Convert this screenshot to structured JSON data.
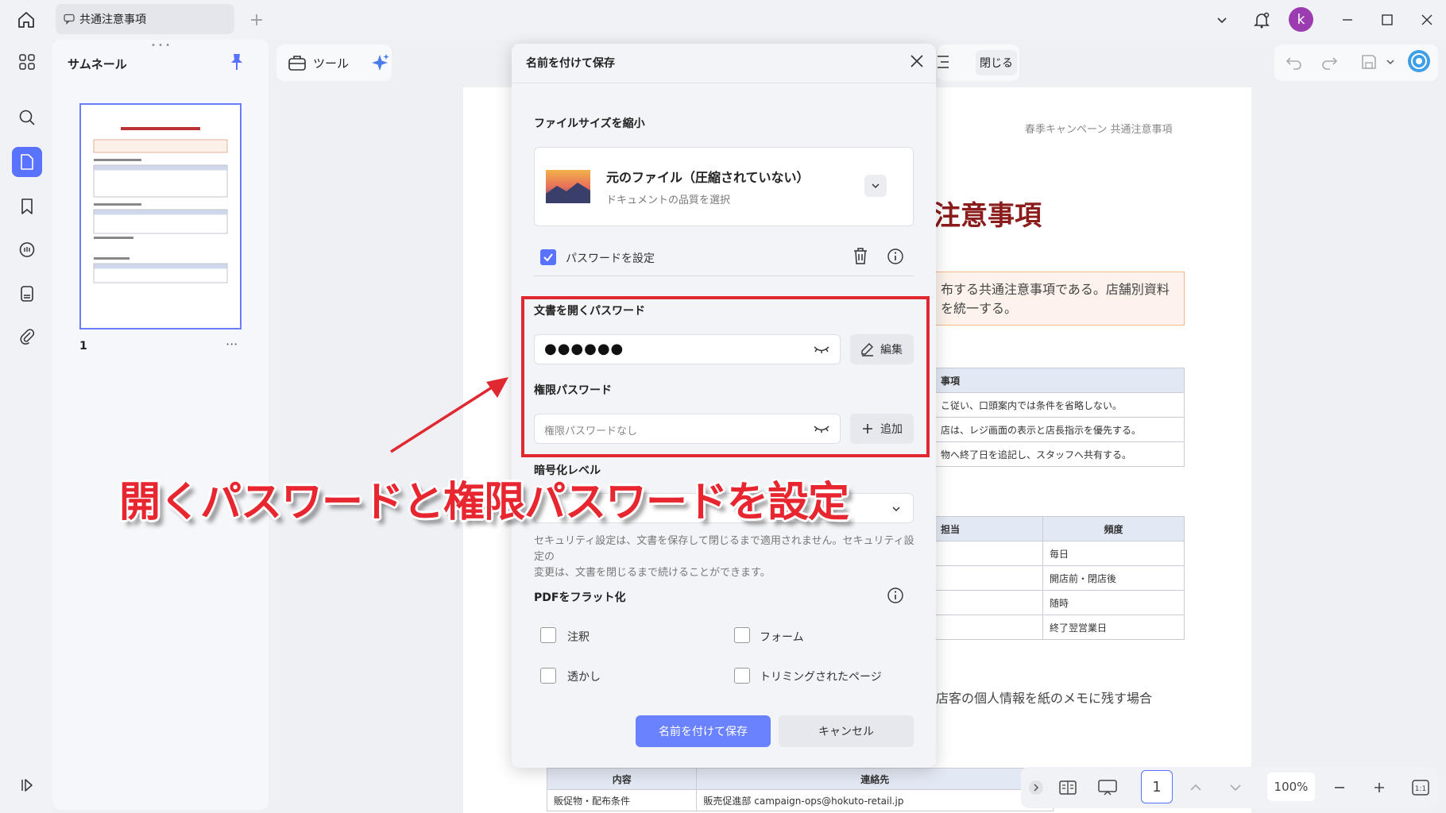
{
  "titlebar": {
    "tab_label": "共通注意事項",
    "new_tab": "+",
    "avatar_initial": "k"
  },
  "thumbnails": {
    "title": "サムネール",
    "page_number": "1",
    "more": "···"
  },
  "toolbar": {
    "tools_label": "ツール",
    "close_label": "閉じる"
  },
  "document": {
    "header": "春季キャンペーン 共通注意事項",
    "title": "注意事項",
    "notice": [
      "布する共通注意事項である。店舗別資料",
      "を統一する。"
    ],
    "table1": {
      "header": "事項",
      "rows": [
        "こ従い、口頭案内では条件を省略しない。",
        "店は、レジ画面の表示と店長指示を優先する。",
        "物へ終了日を追記し、スタッフへ共有する。"
      ]
    },
    "table2": {
      "headers": [
        "担当",
        "頻度"
      ],
      "rows": [
        [
          "",
          "毎日"
        ],
        [
          "",
          "開店前・閉店後"
        ],
        [
          "",
          "随時"
        ],
        [
          "",
          "終了翌営業日"
        ]
      ]
    },
    "line": "店客の個人情報を紙のメモに残す場合",
    "table3": {
      "headers": [
        "内容",
        "連絡先"
      ],
      "rows": [
        [
          "販促物・配布条件",
          "販売促進部 campaign-ops@hokuto-retail.jp"
        ]
      ]
    }
  },
  "dialog": {
    "title": "名前を付けて保存",
    "compress_label": "ファイルサイズを縮小",
    "compress_option_title": "元のファイル（圧縮されていない）",
    "compress_option_sub": "ドキュメントの品質を選択",
    "set_password_label": "パスワードを設定",
    "open_password_label": "文書を開くパスワード",
    "open_password_value": "●●●●●●",
    "edit_label": "編集",
    "permission_password_label": "権限パスワード",
    "permission_password_placeholder": "権限パスワードなし",
    "add_label": "追加",
    "encryption_label": "暗号化レベル",
    "security_note": [
      "セキュリティ設定は、文書を保存して閉じるまで適用されません。セキュリティ設定の",
      "変更は、文書を閉じるまで続けることができます。"
    ],
    "flatten_label": "PDFをフラット化",
    "flatten_options": [
      "注釈",
      "フォーム",
      "透かし",
      "トリミングされたページ"
    ],
    "save_button": "名前を付けて保存",
    "cancel_button": "キャンセル"
  },
  "annotation": {
    "caption": "開くパスワードと権限パスワードを設定",
    "color": "#e02830"
  },
  "bottombar": {
    "page": "1",
    "zoom": "100%",
    "fit": "1:1"
  },
  "colors": {
    "accent": "#5a73ff",
    "doc_title": "#8a1c1c"
  }
}
